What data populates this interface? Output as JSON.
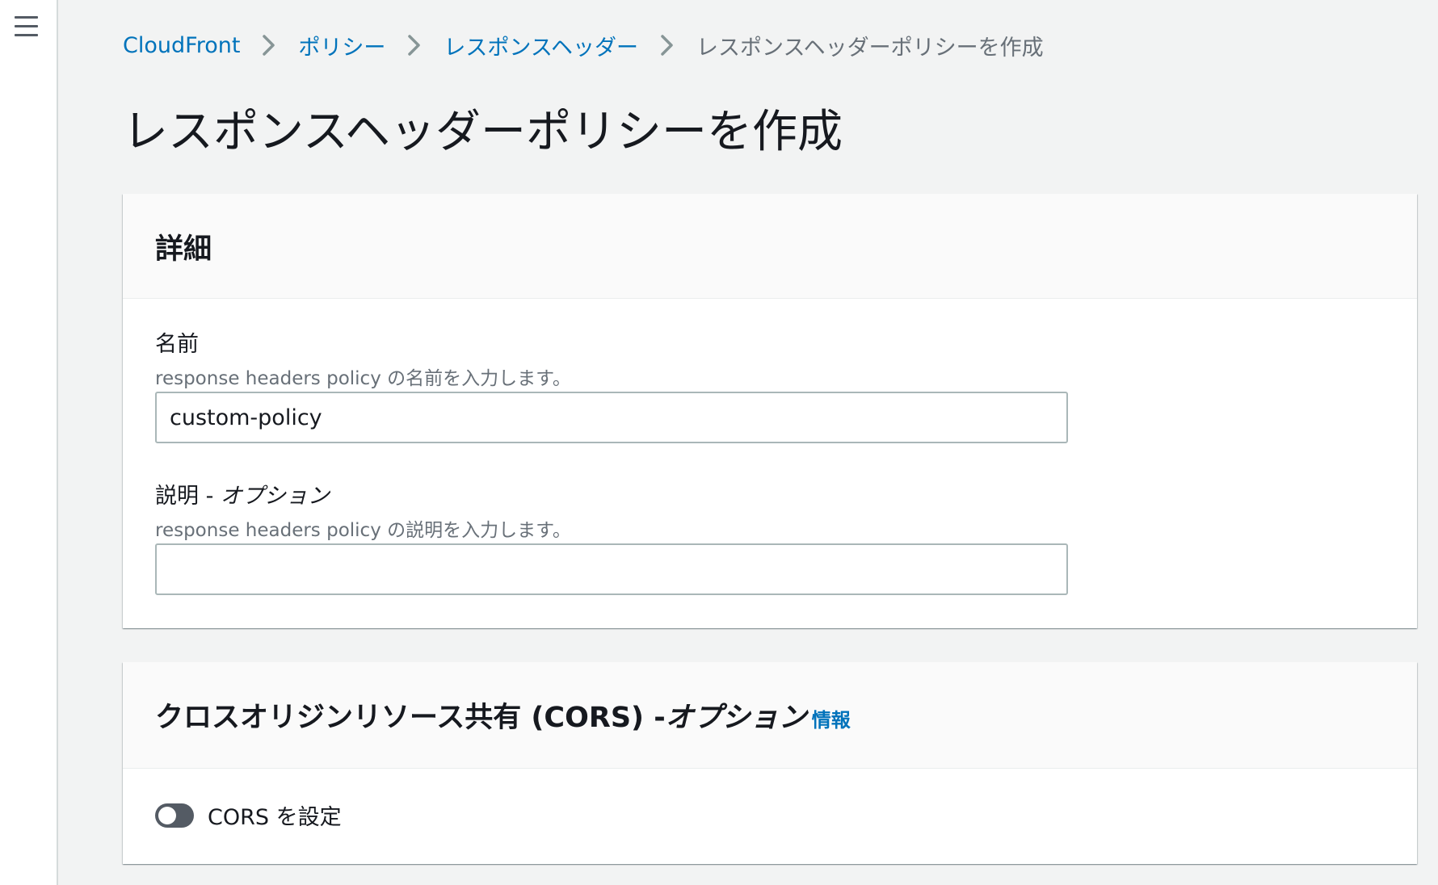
{
  "breadcrumb": {
    "items": [
      "CloudFront",
      "ポリシー",
      "レスポンスヘッダー"
    ],
    "current": "レスポンスヘッダーポリシーを作成"
  },
  "page": {
    "title": "レスポンスヘッダーポリシーを作成"
  },
  "details": {
    "title": "詳細",
    "name_label": "名前",
    "name_desc": "response headers policy の名前を入力します。",
    "name_value": "custom-policy",
    "desc_label_main": "説明 - ",
    "desc_label_optional": "オプション",
    "desc_desc": "response headers policy の説明を入力します。",
    "desc_value": ""
  },
  "cors": {
    "title_main": "クロスオリジンリソース共有 (CORS) -",
    "title_optional": "オプション",
    "info_link": "情報",
    "toggle_label": "CORS を設定",
    "toggle_on": false
  },
  "colors": {
    "link": "#0073bb",
    "text": "#16191f",
    "muted": "#687078",
    "background": "#f2f3f3",
    "toggle_off": "#545b64"
  }
}
